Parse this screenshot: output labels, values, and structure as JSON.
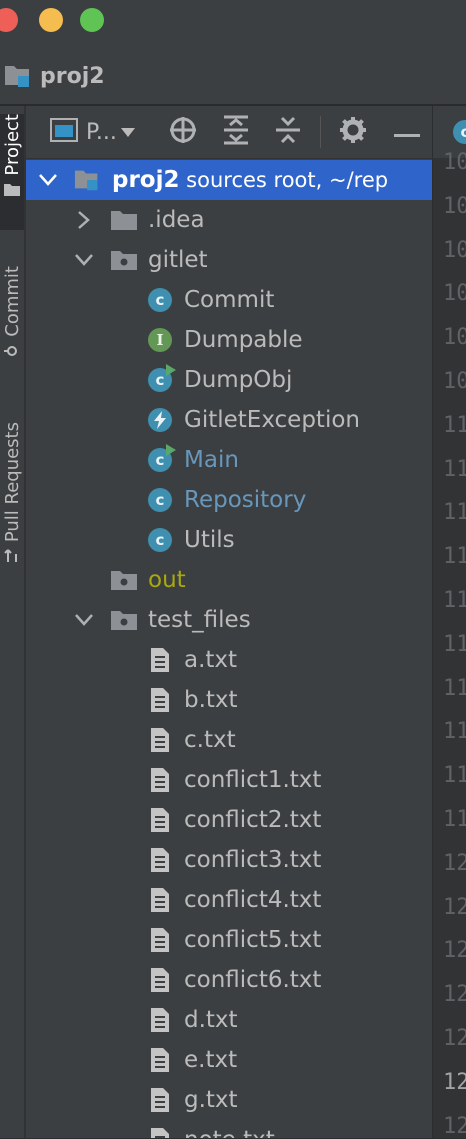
{
  "window": {
    "project_name": "proj2"
  },
  "side_tabs": [
    {
      "label": "Project"
    },
    {
      "label": "Commit"
    },
    {
      "label": "Pull Requests"
    }
  ],
  "toolbar": {
    "view_selector": "P..."
  },
  "tree": [
    {
      "depth": 0,
      "expanded": true,
      "type": "module",
      "name": "proj2",
      "suffix": "sources root, ~/rep",
      "selected": true
    },
    {
      "depth": 1,
      "expanded": false,
      "type": "folder",
      "name": ".idea"
    },
    {
      "depth": 1,
      "expanded": true,
      "type": "package",
      "name": "gitlet"
    },
    {
      "depth": 2,
      "type": "class",
      "name": "Commit"
    },
    {
      "depth": 2,
      "type": "interface",
      "name": "Dumpable"
    },
    {
      "depth": 2,
      "type": "class-runnable",
      "name": "DumpObj"
    },
    {
      "depth": 2,
      "type": "exception",
      "name": "GitletException"
    },
    {
      "depth": 2,
      "type": "class-runnable",
      "name": "Main",
      "color": "#6897bb"
    },
    {
      "depth": 2,
      "type": "class",
      "name": "Repository",
      "color": "#6897bb"
    },
    {
      "depth": 2,
      "type": "class",
      "name": "Utils"
    },
    {
      "depth": 1,
      "type": "package",
      "name": "out",
      "color": "#a8a80f"
    },
    {
      "depth": 1,
      "expanded": true,
      "type": "package",
      "name": "test_files"
    },
    {
      "depth": 2,
      "type": "file",
      "name": "a.txt"
    },
    {
      "depth": 2,
      "type": "file",
      "name": "b.txt"
    },
    {
      "depth": 2,
      "type": "file",
      "name": "c.txt"
    },
    {
      "depth": 2,
      "type": "file",
      "name": "conflict1.txt"
    },
    {
      "depth": 2,
      "type": "file",
      "name": "conflict2.txt"
    },
    {
      "depth": 2,
      "type": "file",
      "name": "conflict3.txt"
    },
    {
      "depth": 2,
      "type": "file",
      "name": "conflict4.txt"
    },
    {
      "depth": 2,
      "type": "file",
      "name": "conflict5.txt"
    },
    {
      "depth": 2,
      "type": "file",
      "name": "conflict6.txt"
    },
    {
      "depth": 2,
      "type": "file",
      "name": "d.txt"
    },
    {
      "depth": 2,
      "type": "file",
      "name": "e.txt"
    },
    {
      "depth": 2,
      "type": "file",
      "name": "g.txt"
    },
    {
      "depth": 2,
      "type": "file",
      "name": "note.txt"
    }
  ],
  "editor": {
    "line_numbers": [
      "10",
      "10",
      "10",
      "10",
      "10",
      "10",
      "11",
      "11",
      "11",
      "11",
      "11",
      "11",
      "11",
      "11",
      "11",
      "11",
      "12",
      "12",
      "12",
      "12",
      "12",
      "12",
      "12"
    ],
    "current_line_index": 21
  },
  "colors": {
    "selection": "#2f65ca",
    "class_icon": "#3f8fb0",
    "interface_icon": "#629755",
    "excluded_folder_text": "#a8a80f",
    "modified_text": "#6897bb"
  }
}
